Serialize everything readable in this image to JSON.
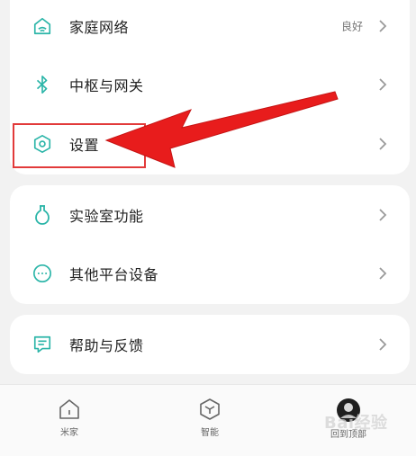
{
  "card1": {
    "items": [
      {
        "label": "家庭网络",
        "status": "良好",
        "icon": "wifi-home-icon"
      },
      {
        "label": "中枢与网关",
        "icon": "bluetooth-icon"
      },
      {
        "label": "设置",
        "icon": "settings-hexagon-icon"
      }
    ]
  },
  "card2": {
    "items": [
      {
        "label": "实验室功能",
        "icon": "flask-icon"
      },
      {
        "label": "其他平台设备",
        "icon": "more-circle-icon"
      }
    ]
  },
  "card3": {
    "items": [
      {
        "label": "帮助与反馈",
        "icon": "feedback-icon"
      }
    ]
  },
  "tabbar": {
    "tabs": [
      {
        "label": "米家",
        "icon": "home-icon"
      },
      {
        "label": "智能",
        "icon": "cube-icon"
      },
      {
        "label": "回到顶部",
        "icon": "avatar-icon"
      }
    ]
  },
  "watermark": "Bai经验",
  "colors": {
    "accent": "#2bb5a8",
    "highlight": "#e23a3a",
    "arrow": "#e81c1c"
  }
}
